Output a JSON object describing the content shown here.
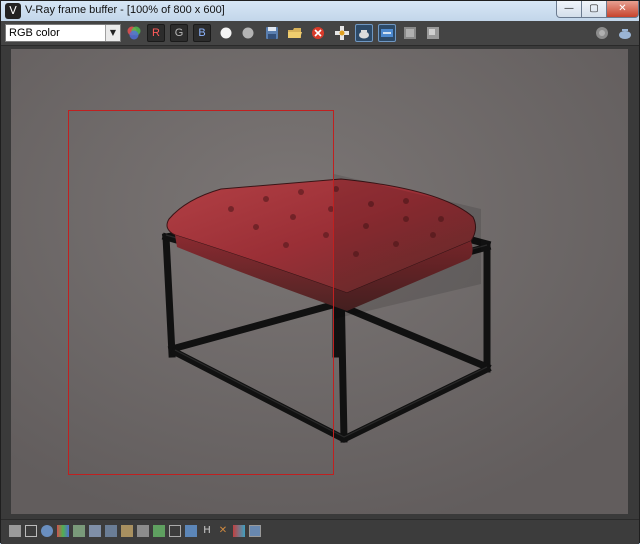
{
  "window": {
    "title": "V-Ray frame buffer - [100% of 800 x 600]",
    "app_icon_glyph": "V",
    "minimize_glyph": "—",
    "maximize_glyph": "▢",
    "close_glyph": "✕"
  },
  "toolbar": {
    "channel_value": "RGB color",
    "red_channel_label": "R",
    "green_channel_label": "G",
    "blue_channel_label": "B"
  },
  "colors": {
    "viewport_background": "#6d6868",
    "region_border": "#c02020",
    "leather": "#9b2f35",
    "frame_metal": "#121212"
  }
}
